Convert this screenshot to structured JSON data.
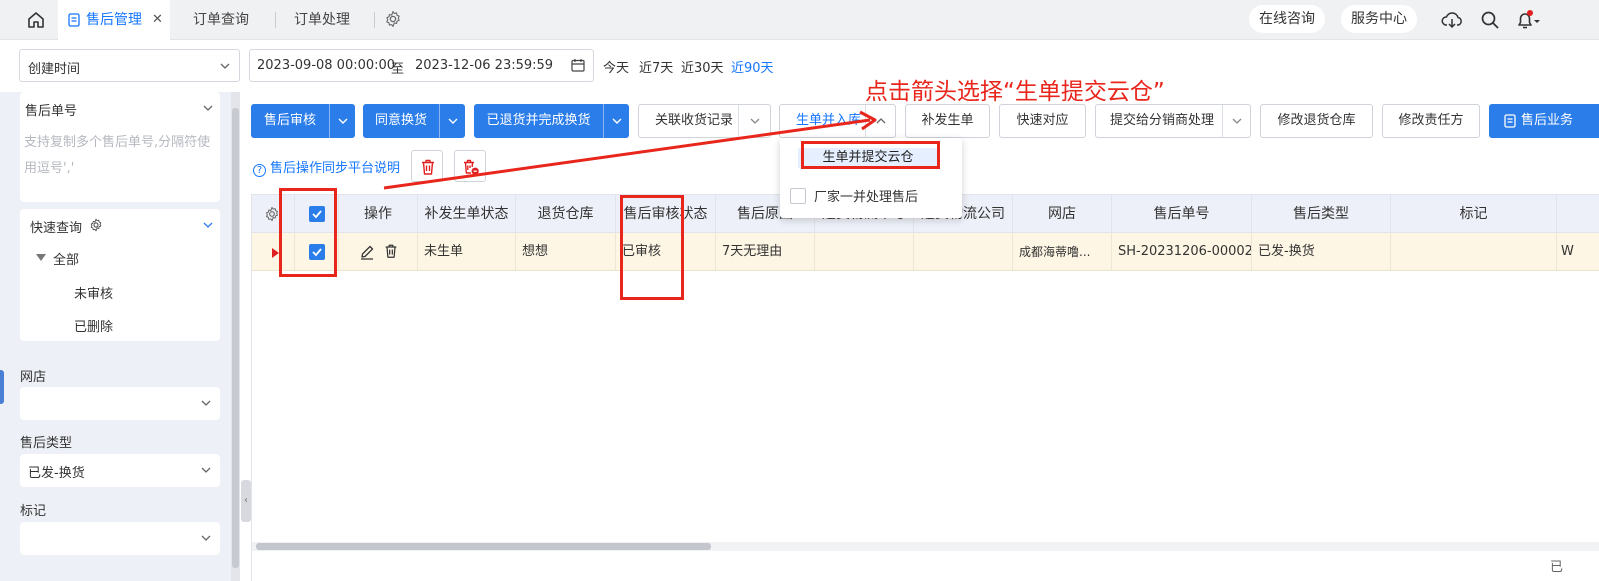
{
  "topbar": {
    "tabs": [
      {
        "label": "售后管理",
        "active": true
      },
      {
        "label": "订单查询",
        "active": false
      },
      {
        "label": "订单处理",
        "active": false
      }
    ],
    "right_buttons": [
      "在线咨询",
      "服务中心"
    ],
    "close_glyph": "✕"
  },
  "filter": {
    "date_type": "创建时间",
    "date_start": "2023-09-08 00:00:00",
    "date_to": "至",
    "date_end": "2023-12-06 23:59:59",
    "quick_dates": [
      "今天",
      "近7天",
      "近30天",
      "近90天"
    ],
    "quick_selected": "近90天"
  },
  "left": {
    "order_no_label": "售后单号",
    "order_no_placeholder": "支持复制多个售后单号,分隔符使用逗号','",
    "quick_query_label": "快速查询",
    "tree_all": "全部",
    "tree_children": [
      "未审核",
      "已删除"
    ],
    "shop_label": "网店",
    "shop_value": "",
    "aftersale_type_label": "售后类型",
    "aftersale_type_value": "已发-换货",
    "mark_label": "标记",
    "mark_value": ""
  },
  "toolbar": {
    "audit": "售后审核",
    "agree_exchange": "同意换货",
    "returned_done_exchange": "已退货并完成换货",
    "related_receipts": "关联收货记录",
    "generate_order_in": "生单并入库",
    "reissue_order": "补发生单",
    "quick_match": "快速对应",
    "submit_distributor": "提交给分销商处理",
    "modify_return_warehouse": "修改退货仓库",
    "modify_responsible": "修改责任方",
    "aftersale_business": "售后业务",
    "sync_note": "售后操作同步平台说明"
  },
  "dropdown": {
    "item1": "生单并提交云仓",
    "item2": "厂家一并处理售后"
  },
  "table": {
    "headers": [
      "操作",
      "补发生单状态",
      "退货仓库",
      "售后审核状态",
      "售后原因",
      "退货物流单号",
      "退货物流公司",
      "网店",
      "售后单号",
      "售后类型",
      "标记"
    ],
    "row": {
      "reissue_status": "未生单",
      "return_warehouse": "想想",
      "audit_status": "已审核",
      "reason": "7天无理由",
      "logistics_no": "",
      "logistics_company": "",
      "shop": "成都海蒂噜...",
      "order_no": "SH-20231206-00002",
      "type": "已发-换货",
      "mark": "",
      "overflow_text": "W"
    },
    "footer_text": "已"
  },
  "annotation": {
    "text": "点击箭头选择“生单提交云仓”"
  },
  "colors": {
    "primary": "#2b7de9",
    "annotation_red": "#e8261c",
    "selected_row": "#fdf6e4",
    "header_bg": "#edf0f8"
  }
}
